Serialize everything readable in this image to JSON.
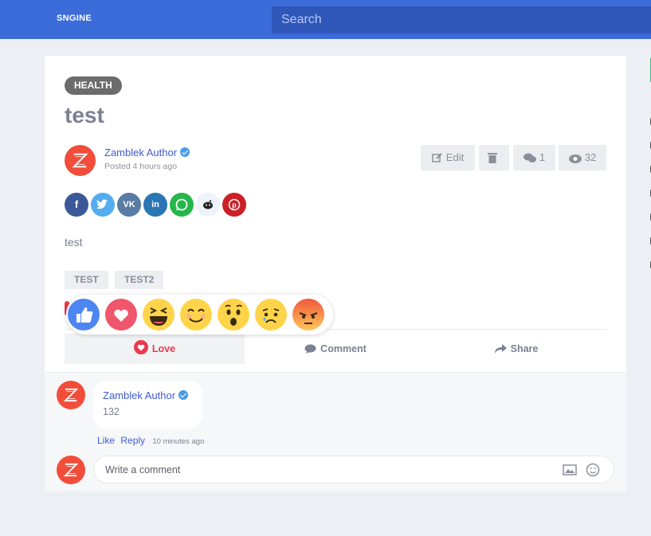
{
  "header": {
    "logo": "SNGINE",
    "search_placeholder": "Search"
  },
  "post": {
    "category": "HEALTH",
    "title": "test",
    "author": "Zamblek Author",
    "posted": "Posted 4 hours ago",
    "actions": {
      "edit_label": "Edit",
      "comments_count": "1",
      "views_count": "32"
    },
    "share_icons": [
      "facebook-icon",
      "twitter-icon",
      "vk-icon",
      "linkedin-icon",
      "whatsapp-icon",
      "reddit-icon",
      "pinterest-icon"
    ],
    "text": "test",
    "tags": [
      "TEST",
      "TEST2"
    ],
    "reactions": [
      "like",
      "love",
      "haha",
      "yay",
      "wow",
      "sad",
      "angry"
    ],
    "tabs": {
      "love": "Love",
      "comment": "Comment",
      "share": "Share"
    }
  },
  "comments": [
    {
      "author": "Zamblek Author",
      "text": "132",
      "like_label": "Like",
      "reply_label": "Reply",
      "time": "10 minutes ago"
    }
  ],
  "comment_input": {
    "placeholder": "Write a comment"
  },
  "colors": {
    "topbar": "#3c6bda",
    "accent": "#e83a4c",
    "link": "#3f5bd0"
  }
}
